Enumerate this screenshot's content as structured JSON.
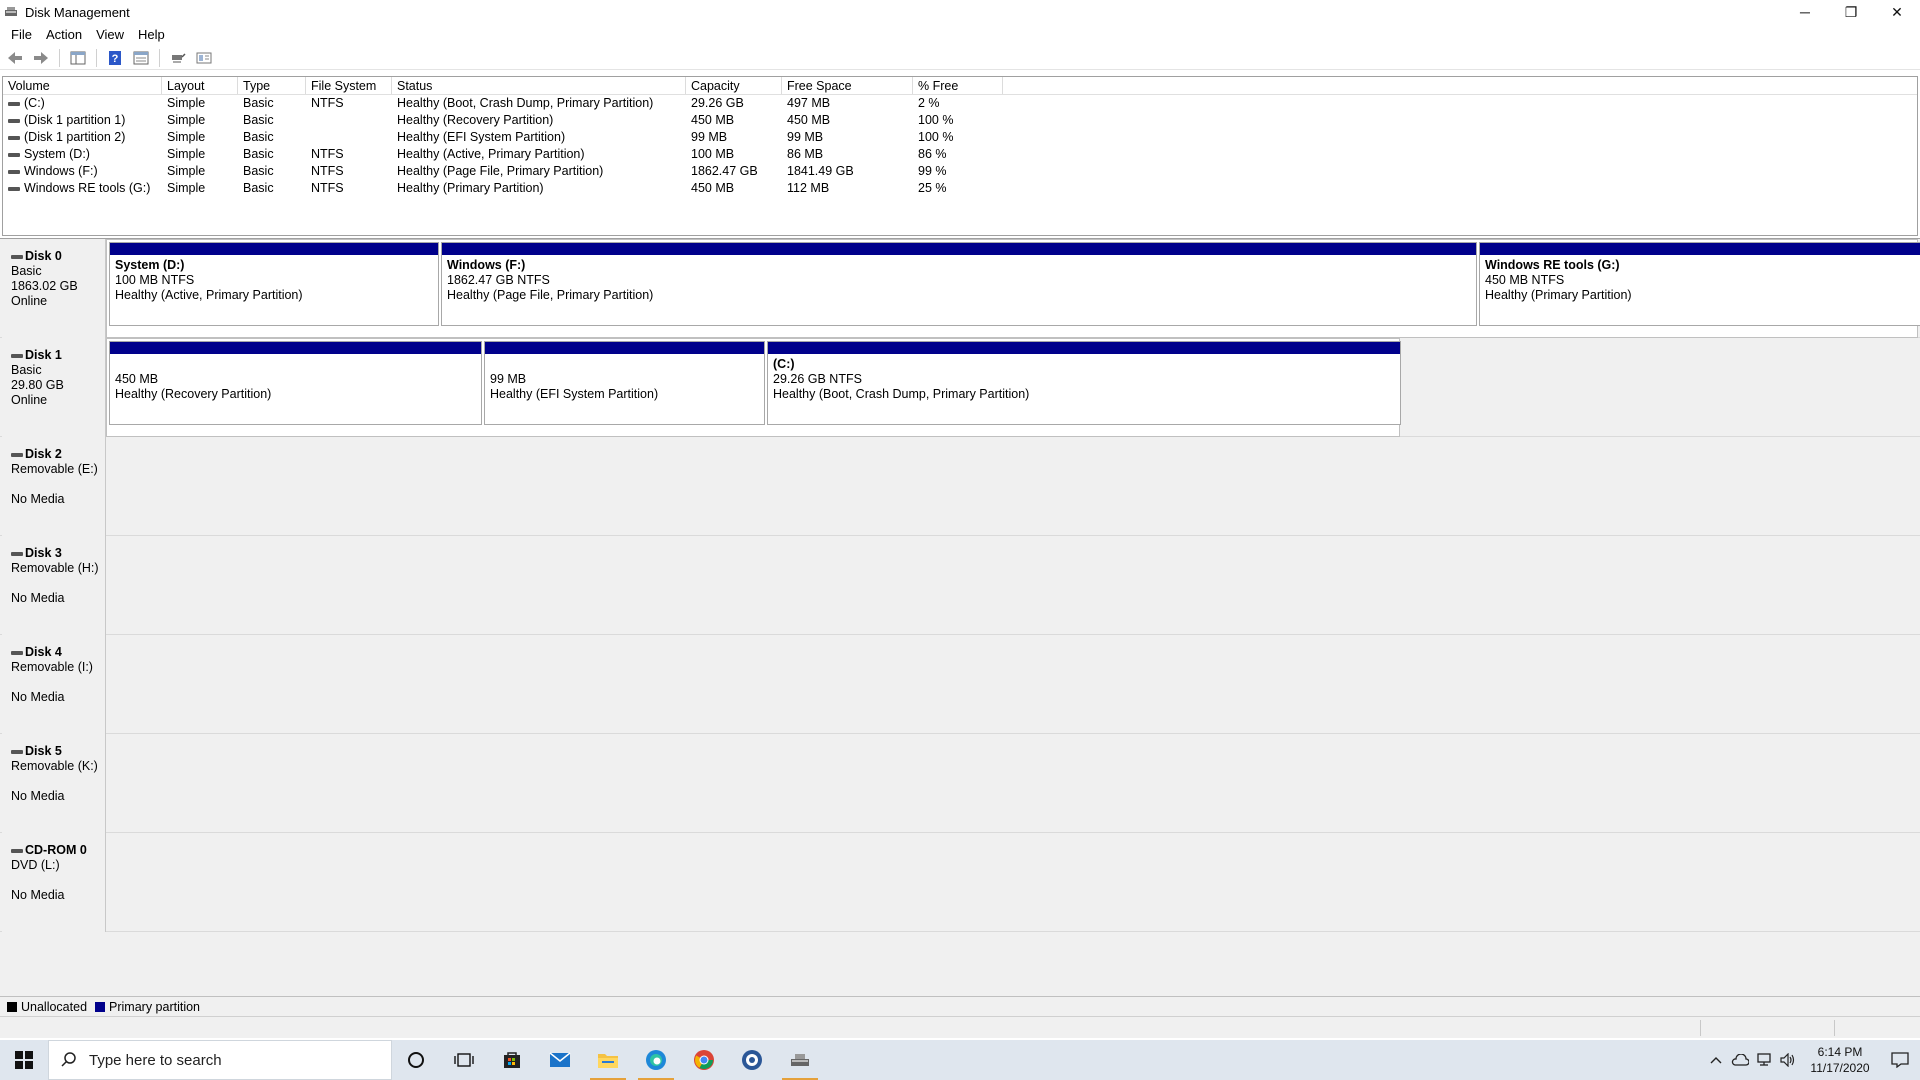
{
  "window": {
    "title": "Disk Management",
    "controls": {
      "minimize": "─",
      "restore": "❐",
      "close": "✕"
    }
  },
  "menu": [
    "File",
    "Action",
    "View",
    "Help"
  ],
  "volume_list": {
    "columns": [
      "Volume",
      "Layout",
      "Type",
      "File System",
      "Status",
      "Capacity",
      "Free Space",
      "% Free"
    ],
    "rows": [
      [
        "(C:)",
        "Simple",
        "Basic",
        "NTFS",
        "Healthy (Boot, Crash Dump, Primary Partition)",
        "29.26 GB",
        "497 MB",
        "2 %"
      ],
      [
        "(Disk 1 partition 1)",
        "Simple",
        "Basic",
        "",
        "Healthy (Recovery Partition)",
        "450 MB",
        "450 MB",
        "100 %"
      ],
      [
        "(Disk 1 partition 2)",
        "Simple",
        "Basic",
        "",
        "Healthy (EFI System Partition)",
        "99 MB",
        "99 MB",
        "100 %"
      ],
      [
        "System (D:)",
        "Simple",
        "Basic",
        "NTFS",
        "Healthy (Active, Primary Partition)",
        "100 MB",
        "86 MB",
        "86 %"
      ],
      [
        "Windows (F:)",
        "Simple",
        "Basic",
        "NTFS",
        "Healthy (Page File, Primary Partition)",
        "1862.47 GB",
        "1841.49 GB",
        "99 %"
      ],
      [
        "Windows RE tools (G:)",
        "Simple",
        "Basic",
        "NTFS",
        "Healthy (Primary Partition)",
        "450 MB",
        "112 MB",
        "25 %"
      ]
    ]
  },
  "disks": [
    {
      "name": "Disk 0",
      "line1": "Basic",
      "line2": "1863.02 GB",
      "line3": "Online",
      "partitions": [
        {
          "name": "System  (D:)",
          "size": "100 MB NTFS",
          "status": "Healthy (Active, Primary Partition)"
        },
        {
          "name": "Windows  (F:)",
          "size": "1862.47 GB NTFS",
          "status": "Healthy (Page File, Primary Partition)"
        },
        {
          "name": "Windows RE tools  (G:)",
          "size": "450 MB NTFS",
          "status": "Healthy (Primary Partition)"
        }
      ]
    },
    {
      "name": "Disk 1",
      "line1": "Basic",
      "line2": "29.80 GB",
      "line3": "Online",
      "partitions": [
        {
          "name": "",
          "size": "450 MB",
          "status": "Healthy (Recovery Partition)"
        },
        {
          "name": "",
          "size": "99 MB",
          "status": "Healthy (EFI System Partition)"
        },
        {
          "name": "(C:)",
          "size": "29.26 GB NTFS",
          "status": "Healthy (Boot, Crash Dump, Primary Partition)"
        }
      ]
    },
    {
      "name": "Disk 2",
      "line1": "Removable (E:)",
      "line2": "",
      "line3": "No Media",
      "partitions": []
    },
    {
      "name": "Disk 3",
      "line1": "Removable (H:)",
      "line2": "",
      "line3": "No Media",
      "partitions": []
    },
    {
      "name": "Disk 4",
      "line1": "Removable (I:)",
      "line2": "",
      "line3": "No Media",
      "partitions": []
    },
    {
      "name": "Disk 5",
      "line1": "Removable (K:)",
      "line2": "",
      "line3": "No Media",
      "partitions": []
    },
    {
      "name": "CD-ROM 0",
      "line1": "DVD (L:)",
      "line2": "",
      "line3": "No Media",
      "partitions": []
    }
  ],
  "legend": [
    {
      "label": "Unallocated",
      "color": "#000000"
    },
    {
      "label": "Primary partition",
      "color": "#00008b"
    }
  ],
  "taskbar": {
    "search_placeholder": "Type here to search",
    "apps": [
      "cortana-icon",
      "task-view-icon",
      "store-icon",
      "mail-icon",
      "file-explorer-icon",
      "edge-icon",
      "chrome-icon",
      "app-icon",
      "disk-management-icon"
    ],
    "clock_time": "6:14 PM",
    "clock_date": "11/17/2020"
  },
  "colors": {
    "primary_partition": "#00008b",
    "taskbar_bg": "#dfe6ee",
    "running_indicator": "#e5a13a"
  }
}
